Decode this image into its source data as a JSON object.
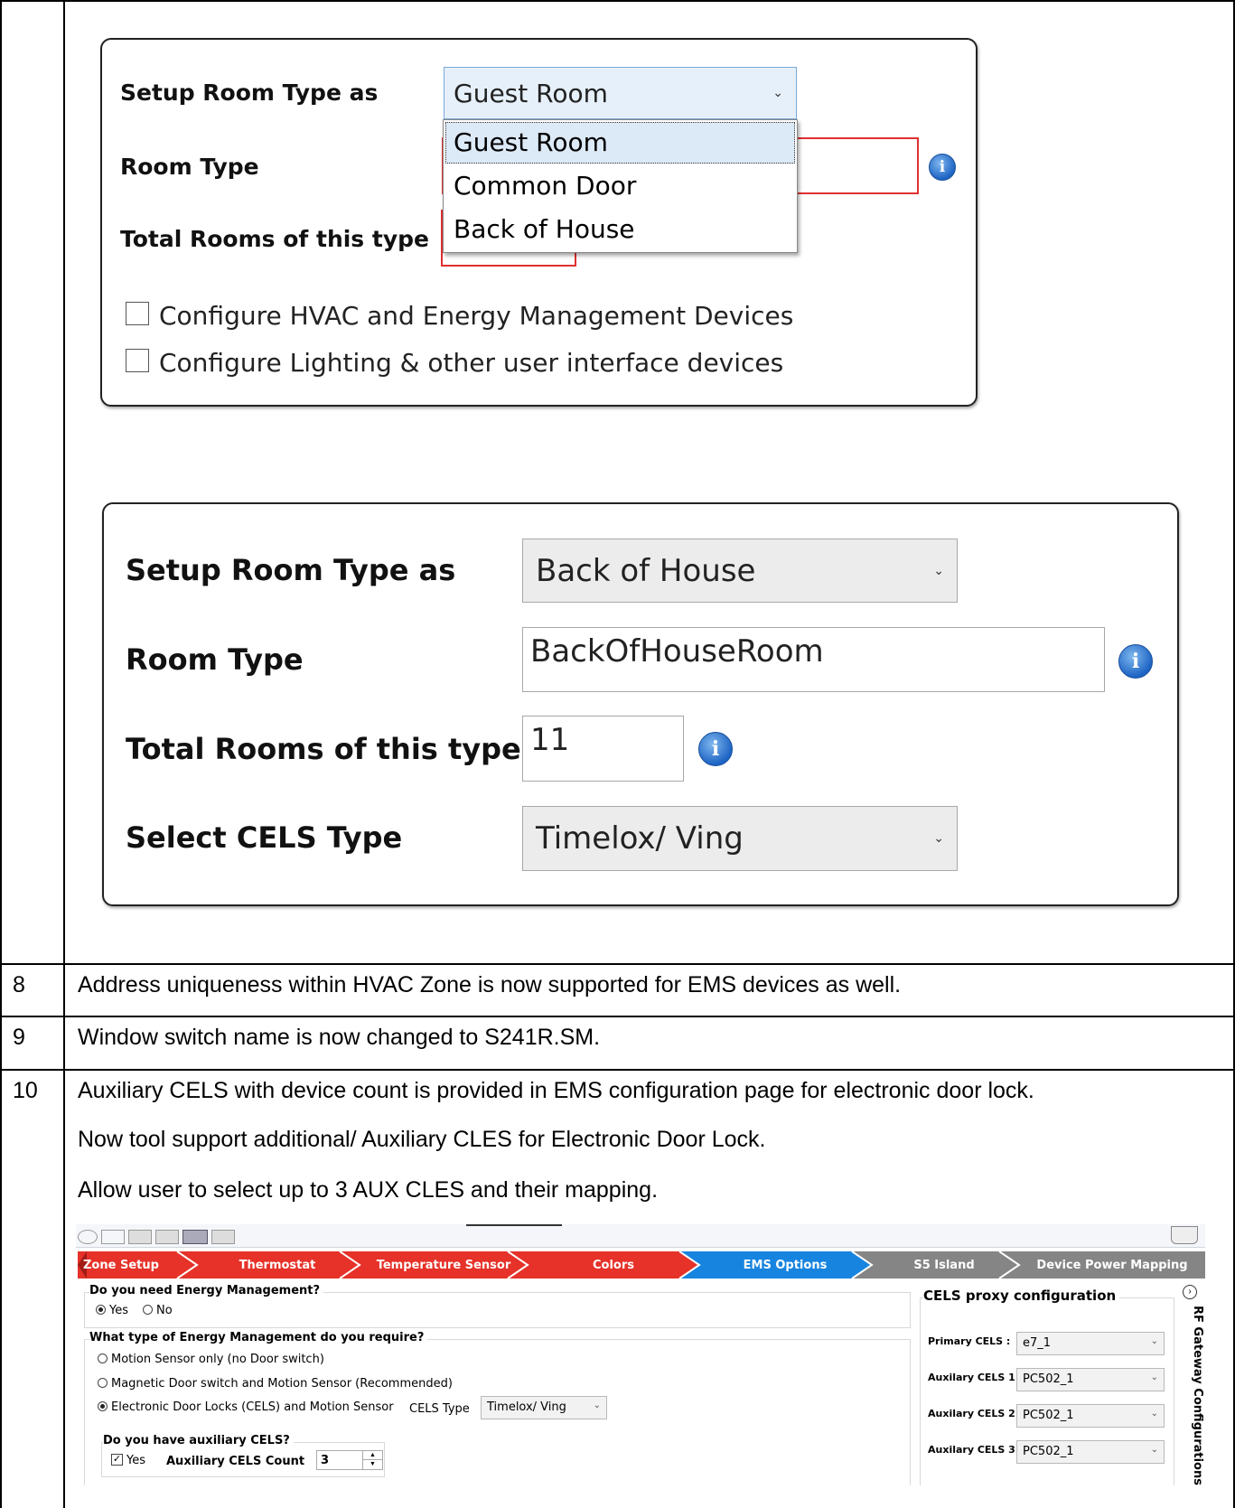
{
  "panel1": {
    "setup_label": "Setup Room Type as",
    "setup_value": "Guest Room",
    "room_type_label": "Room Type",
    "total_label": "Total Rooms of this type",
    "dropdown_options": [
      "Guest Room",
      "Common Door",
      "Back of House"
    ],
    "checkbox_hvac": "Configure HVAC and Energy Management Devices",
    "checkbox_lighting": "Configure Lighting & other user interface devices"
  },
  "panel2": {
    "setup_label": "Setup Room Type as",
    "setup_value": "Back of House",
    "room_type_label": "Room Type",
    "room_type_value": "BackOfHouseRoom",
    "total_label": "Total Rooms of this type",
    "total_value": "11",
    "cels_label": "Select CELS Type",
    "cels_value": "Timelox/ Ving"
  },
  "rows": [
    {
      "num": "8",
      "text": "Address uniqueness within HVAC Zone is now supported for EMS devices as well."
    },
    {
      "num": "9",
      "text": "Window switch name is now changed to S241R.SM."
    },
    {
      "num": "10",
      "lines": [
        "Auxiliary CELS with device count is provided in EMS configuration page for electronic door lock.",
        "Now tool support additional/ Auxiliary CLES for Electronic Door Lock.",
        "Allow user to select up to 3 AUX CLES and their mapping."
      ]
    }
  ],
  "ems": {
    "breadcrumb": [
      "Zone Setup",
      "Thermostat",
      "Temperature Sensor",
      "Colors",
      "EMS Options",
      "S5 Island",
      "Device Power Mapping"
    ],
    "q_energy": "Do you need Energy Management?",
    "yes": "Yes",
    "no": "No",
    "q_type": "What type of Energy Management do you require?",
    "opt_motion": "Motion Sensor only (no Door switch)",
    "opt_magnetic": "Magnetic Door switch  and Motion Sensor (Recommended)",
    "opt_cels": "Electronic Door Locks (CELS) and Motion Sensor",
    "cels_type_label": "CELS Type",
    "cels_type_value": "Timelox/ Ving",
    "q_aux": "Do you have auxiliary CELS?",
    "aux_yes": "Yes",
    "aux_count_label": "Auxiliary CELS Count",
    "aux_count_value": "3",
    "proxy_title": "CELS proxy configuration",
    "primary_label": "Primary CELS  :",
    "primary_value": "e7_1",
    "aux1_label": "Auxilary CELS 1:",
    "aux1_value": "PC502_1",
    "aux2_label": "Auxilary CELS 2:",
    "aux2_value": "PC502_1",
    "aux3_label": "Auxilary CELS 3:",
    "aux3_value": "PC502_1",
    "rf_gateway": "RF Gateway Configurations"
  }
}
